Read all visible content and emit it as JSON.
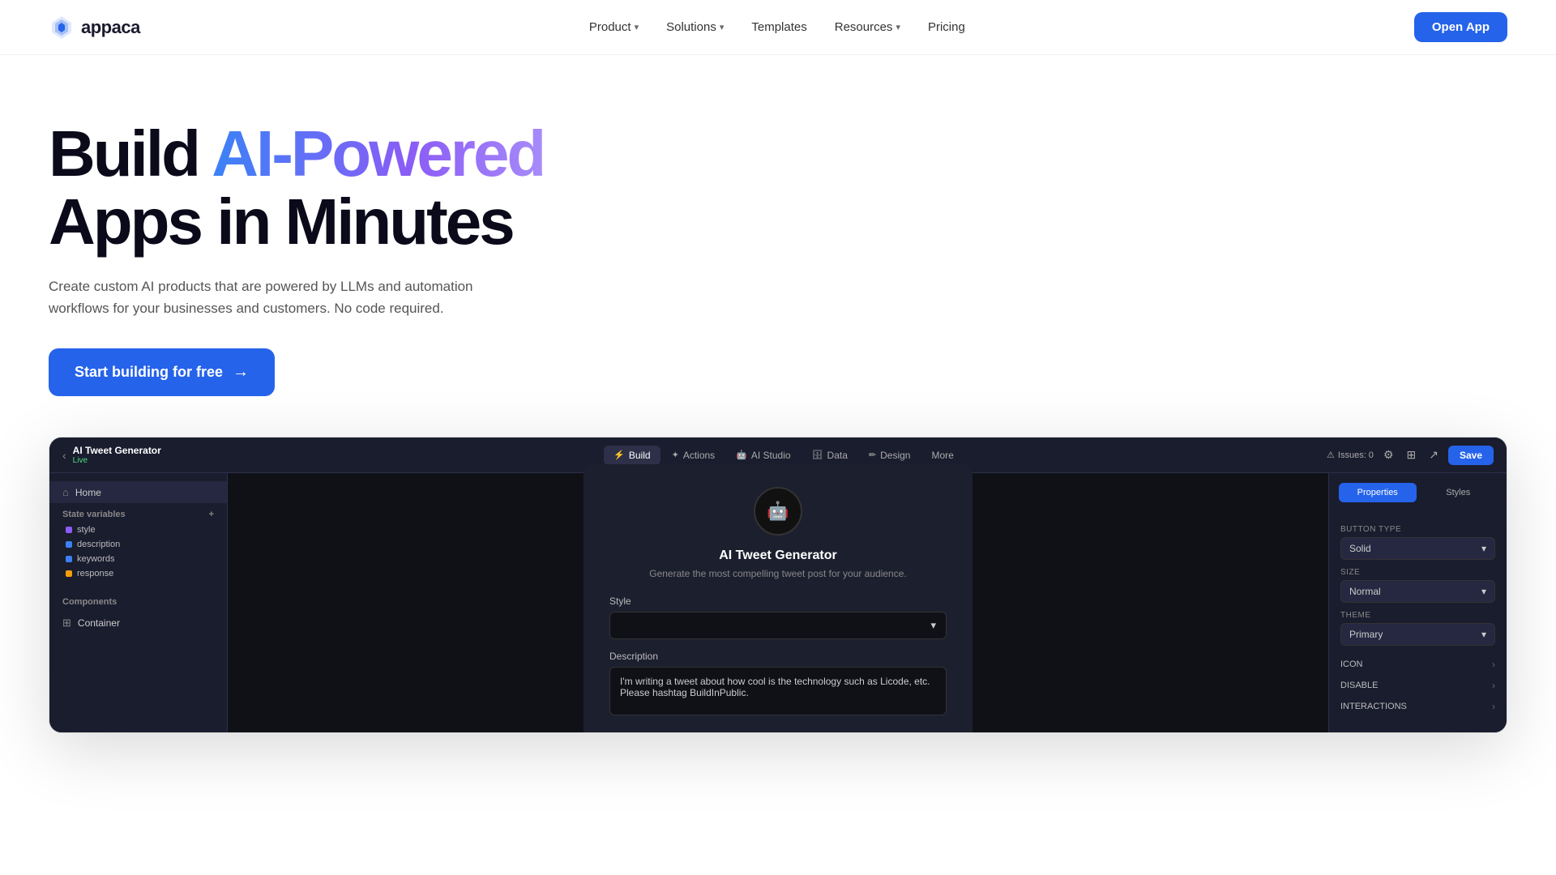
{
  "brand": {
    "name": "appaca",
    "logo_symbol": "✦"
  },
  "nav": {
    "links": [
      {
        "id": "product",
        "label": "Product",
        "has_dropdown": true
      },
      {
        "id": "solutions",
        "label": "Solutions",
        "has_dropdown": true
      },
      {
        "id": "templates",
        "label": "Templates",
        "has_dropdown": false
      },
      {
        "id": "resources",
        "label": "Resources",
        "has_dropdown": true
      },
      {
        "id": "pricing",
        "label": "Pricing",
        "has_dropdown": false
      }
    ],
    "cta_label": "Open App"
  },
  "hero": {
    "title_plain": "Build ",
    "title_gradient": "AI-Powered",
    "title_plain2": "Apps in Minutes",
    "subtitle": "Create custom AI products that are powered by LLMs and automation workflows for your businesses and customers. No code required.",
    "cta_label": "Start building for free",
    "cta_arrow": "→"
  },
  "app_preview": {
    "title": "AI Tweet Generator",
    "live_label": "Live",
    "tabs": [
      {
        "id": "build",
        "label": "Build",
        "icon": "⚡",
        "active": true
      },
      {
        "id": "actions",
        "label": "Actions",
        "icon": "✦",
        "active": false
      },
      {
        "id": "ai_studio",
        "label": "AI Studio",
        "icon": "🤖",
        "active": false
      },
      {
        "id": "data",
        "label": "Data",
        "icon": "🗄",
        "active": false
      },
      {
        "id": "design",
        "label": "Design",
        "icon": "✏",
        "active": false
      },
      {
        "id": "more",
        "label": "More",
        "icon": "•••",
        "active": false
      }
    ],
    "issues_count": 0,
    "issues_label": "Issues: 0",
    "save_label": "Save",
    "left_panel": {
      "home_label": "Home",
      "state_vars_label": "State variables",
      "vars": [
        {
          "name": "style",
          "color": "purple"
        },
        {
          "name": "description",
          "color": "blue"
        },
        {
          "name": "keywords",
          "color": "blue"
        },
        {
          "name": "response",
          "color": "orange"
        }
      ],
      "components_label": "Components",
      "components_sub": "Container"
    },
    "center": {
      "app_name": "AI Tweet Generator",
      "app_subtitle": "Generate the most compelling tweet post for your audience.",
      "style_label": "Style",
      "style_placeholder": "",
      "description_label": "Description",
      "description_placeholder": "I'm writing a tweet about how cool is the technology such as Licode, etc. Please hashtag BuildInPublic."
    },
    "right_panel": {
      "tab_properties": "Properties",
      "tab_styles": "Styles",
      "active_tab": "properties",
      "button_type_label": "Button type",
      "button_type_value": "Solid",
      "size_label": "Size",
      "size_value": "Normal",
      "theme_label": "Theme",
      "theme_value": "Primary",
      "rows": [
        {
          "label": "ICON"
        },
        {
          "label": "DISABLE"
        },
        {
          "label": "INTERACTIONS"
        }
      ]
    }
  }
}
